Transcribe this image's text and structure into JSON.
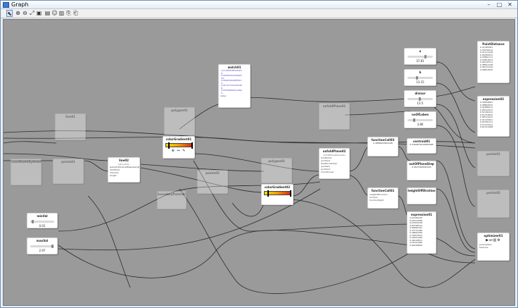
{
  "window": {
    "title": "Graph",
    "minimize": "–",
    "maximize": "□",
    "close": "✕"
  },
  "toolbar": {
    "icons": [
      "pointer-icon",
      "zoom-in-icon",
      "zoom-out-icon",
      "zoom-fit-icon",
      "image-icon",
      "open-icon",
      "user-icon",
      "save-icon",
      "copy-icon",
      "paste-icon"
    ],
    "glyphs": [
      "⬉",
      "⊕",
      "⊖",
      "⤢",
      "▣",
      "▤",
      "☺",
      "▥",
      "⎘",
      "⎗"
    ]
  },
  "nodes": {
    "watch01": {
      "title": "watch01",
      "values": [
        "{0.1026338559423",
        "6,",
        "0.02081202164623",
        "16,",
        "0.00925402085511",
        "3,",
        "0.01707742103106",
        "8,",
        "0.03039580411269",
        "5,"
      ],
      "port": "value"
    },
    "polygon01": {
      "title": "polygon01"
    },
    "line01_dim": {
      "title": "line01"
    },
    "coordinateSystem01": {
      "title": "coordinateSystem01"
    },
    "pointsb": {
      "title": "points01"
    },
    "line02": {
      "title": "line02",
      "sub": "xyFunction",
      "ports": [
        "&emptyPointListBasedLength",
        "startPoint",
        "direction",
        "length",
        "numPoint",
        "endPoint"
      ]
    },
    "colorGradient01": {
      "title": "colorGradient01"
    },
    "colorGradient02": {
      "title": "colorGradient02"
    },
    "unfoldPlane01": {
      "title": "unfoldPlane01"
    },
    "unfoldPlane02": {
      "title": "unfoldPlane02",
      "sub": "unfoldPlaneEvaluator",
      "ports": [
        "bindFactor",
        "pointList",
        "fixedPointIndex",
        "gradient",
        "pointList",
        "smoothness",
        "scaleFactor"
      ]
    },
    "polygon02": {
      "title": "polygon02"
    },
    "function01": {
      "title": "functionCall03",
      "values": [
        "0.4886614909198"
      ]
    },
    "function02": {
      "title": "functionCall01",
      "ports": [
        "heightOfFunction",
        "function",
        "functionRight"
      ]
    },
    "points02": {
      "title": "points02"
    },
    "boundary01": {
      "title": "boundaryPoints01"
    },
    "min": {
      "title": "minVal",
      "value": "0.01"
    },
    "max": {
      "title": "maxVal",
      "value": "2.97"
    },
    "n1": {
      "title": "a",
      "value": "37.81"
    },
    "n2": {
      "title": "b",
      "value": "13.15"
    },
    "n3": {
      "title": "divisor",
      "value": "12.5"
    },
    "n4": {
      "title": "noOfLobes",
      "value": "3.80"
    },
    "centroid": {
      "title": "centroid01",
      "values": [
        "0.4496874018989485"
      ]
    },
    "outofplane": {
      "title": "outOfPlaneStep",
      "values": [
        "0.6627965895935"
      ]
    },
    "heightCtrl": {
      "title": "heightOffiltration"
    },
    "expr01": {
      "title": "expression01",
      "values": [
        "0.91320410",
        "0.07411580",
        "0.07611518",
        "0.87428312",
        "0.99620191",
        "0.37713180",
        "0.46841290",
        "0.33817812",
        "0.32611460",
        "0.49122811",
        "0.21911580",
        "0.64418800"
      ]
    },
    "pointDist": {
      "title": "PointDistance",
      "values": [
        "0.21381581",
        "0.18134212",
        "0.31113148",
        "0.26381501",
        "0.33861171",
        "0.43811813",
        "0.45118711",
        "0.38813148",
        "0.46131124",
        "0.58811610"
      ]
    },
    "expr02": {
      "title": "expression02",
      "values": [
        "0.34814801",
        "0.38861810",
        "0.41884211",
        "0.28114311",
        "0.51184141",
        "0.61312810",
        "0.48713331",
        "0.31133401",
        "0.91381111",
        "0.57114231",
        "0.61311488"
      ]
    },
    "pointR": {
      "title": "points01"
    },
    "pointR2": {
      "title": "points02"
    },
    "optimizer": {
      "title": "optimizer01",
      "ports": [
        "parameters",
        "features"
      ]
    }
  }
}
